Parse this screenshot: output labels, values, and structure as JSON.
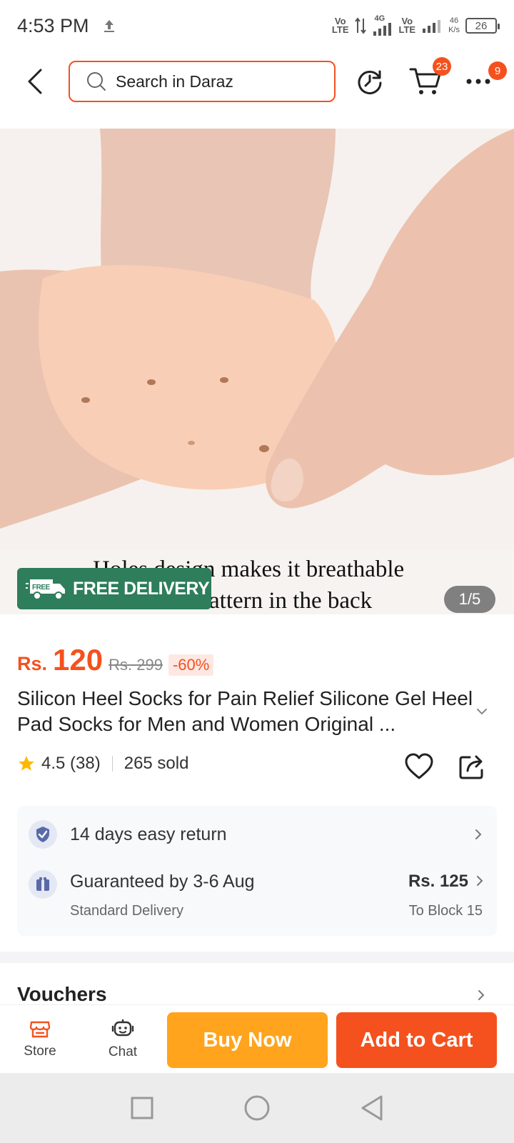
{
  "status": {
    "time": "4:53 PM",
    "net1_top": "Vo",
    "net1_bottom": "LTE",
    "net_type": "4G",
    "net2_top": "Vo",
    "net2_bottom": "LTE",
    "speed_value": "46",
    "speed_unit": "K/s",
    "battery": "26"
  },
  "header": {
    "search_placeholder": "Search in Daraz",
    "cart_count": "23",
    "more_count": "9"
  },
  "gallery": {
    "caption_line1": "Holes design makes it breathable",
    "caption_line2": "attern in the back",
    "free_tag": "FREE",
    "free_delivery": "FREE DELIVERY",
    "page_indicator": "1/5"
  },
  "product": {
    "currency": "Rs.",
    "price": "120",
    "old_price": "Rs. 299",
    "discount": "-60%",
    "title": "Silicon Heel Socks for Pain Relief Silicone Gel Heel Pad Socks for Men and Women Original ...",
    "rating": "4.5 (38)",
    "sold": "265 sold"
  },
  "info": {
    "return_text": "14 days easy return",
    "delivery_title": "Guaranteed by 3-6 Aug",
    "delivery_type": "Standard Delivery",
    "delivery_price": "Rs. 125",
    "delivery_to": "To Block 15"
  },
  "vouchers": {
    "label": "Vouchers"
  },
  "bottom": {
    "store_label": "Store",
    "chat_label": "Chat",
    "buy_now": "Buy Now",
    "add_to_cart": "Add to Cart"
  },
  "colors": {
    "accent": "#f4511e",
    "buy_now": "#ffa41c",
    "free_delivery": "#2e7d5b",
    "star": "#ffb800"
  }
}
